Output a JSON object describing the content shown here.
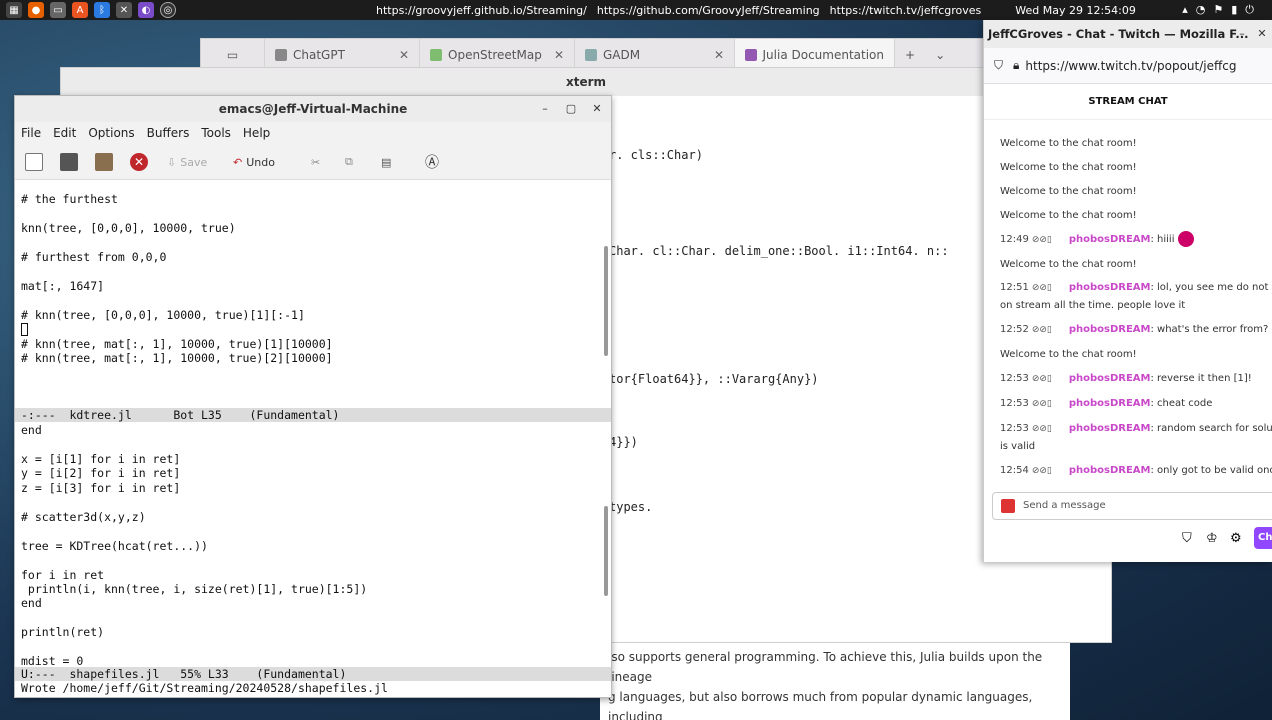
{
  "topbar": {
    "links": [
      "https://groovyjeff.github.io/Streaming/",
      "https://github.com/GroovyJeff/Streaming",
      "https://twitch.tv/jeffcgroves"
    ],
    "datetime": "Wed May 29  12:54:09"
  },
  "firefox": {
    "tabs": [
      {
        "label": "ChatGPT"
      },
      {
        "label": "OpenStreetMap"
      },
      {
        "label": "GADM"
      },
      {
        "label": "Julia Documentation"
      }
    ],
    "new_tab": "+",
    "doc_lines": [
      "lso supports general programming. To achieve this, Julia builds upon the lineage",
      "g languages, but also borrows much from popular dynamic languages, including"
    ]
  },
  "xterm": {
    "title": "xterm",
    "lines": [
      "r. cls::Char)",
      "Char. cl::Char. delim_one::Bool. i1::Int64. n::",
      "tor{Float64}}, ::Vararg{Any})",
      "4}})",
      "types."
    ]
  },
  "emacs": {
    "title": "emacs@Jeff-Virtual-Machine",
    "menu": [
      "File",
      "Edit",
      "Options",
      "Buffers",
      "Tools",
      "Help"
    ],
    "toolbar": {
      "save": "Save",
      "undo": "Undo"
    },
    "top_buffer": [
      "# the furthest",
      "",
      "knn(tree, [0,0,0], 10000, true)",
      "",
      "# furthest from 0,0,0",
      "",
      "mat[:, 1647]",
      "",
      "# knn(tree, [0,0,0], 10000, true)[1][:-1]",
      "",
      "# knn(tree, mat[:, 1], 10000, true)[1][10000]",
      "# knn(tree, mat[:, 1], 10000, true)[2][10000]"
    ],
    "top_modeline": "-:---  kdtree.jl      Bot L35    (Fundamental)",
    "bottom_buffer": [
      "end",
      "",
      "x = [i[1] for i in ret]",
      "y = [i[2] for i in ret]",
      "z = [i[3] for i in ret]",
      "",
      "# scatter3d(x,y,z)",
      "",
      "tree = KDTree(hcat(ret...))",
      "",
      "for i in ret",
      " println(i, knn(tree, i, size(ret)[1], true)[1:5])",
      "end",
      "",
      "println(ret)",
      "",
      "mdist = 0"
    ],
    "bottom_modeline": "U:---  shapefiles.jl   55% L33    (Fundamental)",
    "echo": "Wrote /home/jeff/Git/Streaming/20240528/shapefiles.jl"
  },
  "twitch": {
    "window_title": "JeffCGroves - Chat - Twitch — Mozilla F...",
    "url": "https://www.twitch.tv/popout/jeffcg",
    "header": "STREAM CHAT",
    "messages": [
      {
        "text": "Welcome to the chat room!"
      },
      {
        "text": "Welcome to the chat room!"
      },
      {
        "text": "Welcome to the chat room!"
      },
      {
        "text": "Welcome to the chat room!"
      },
      {
        "time": "12:49",
        "user": "phobosDREAM",
        "text": ": hiiii"
      },
      {
        "text": "Welcome to the chat room!"
      },
      {
        "time": "12:51",
        "user": "phobosDREAM",
        "text": ": lol, you see me do not wo",
        "cont": "on stream all the time. people love it"
      },
      {
        "time": "12:52",
        "user": "phobosDREAM",
        "text": ": what's the error from?"
      },
      {
        "text": "Welcome to the chat room!"
      },
      {
        "time": "12:53",
        "user": "phobosDREAM",
        "text": ": reverse it then [1]!"
      },
      {
        "time": "12:53",
        "user": "phobosDREAM",
        "text": ": cheat code"
      },
      {
        "time": "12:53",
        "user": "phobosDREAM",
        "text": ": random search for soluti",
        "cont": "is valid"
      },
      {
        "time": "12:54",
        "user": "phobosDREAM",
        "text": ": only got to be valid once"
      }
    ],
    "input_placeholder": "Send a message",
    "chat_button": "Ch"
  }
}
